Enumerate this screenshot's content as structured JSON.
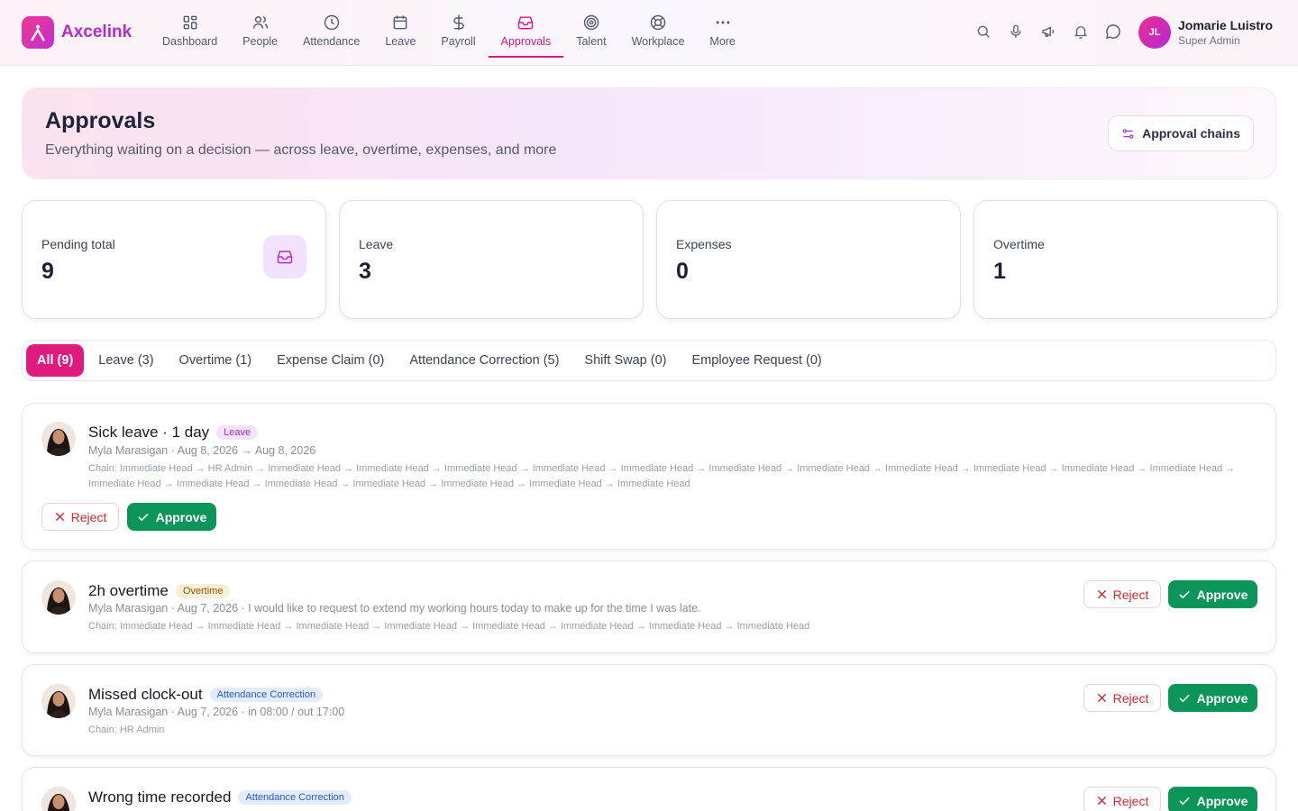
{
  "brand": {
    "name": "Axcelink"
  },
  "nav": [
    {
      "label": "Dashboard",
      "icon": "grid-icon"
    },
    {
      "label": "People",
      "icon": "users-icon"
    },
    {
      "label": "Attendance",
      "icon": "clock-icon"
    },
    {
      "label": "Leave",
      "icon": "calendar-icon"
    },
    {
      "label": "Payroll",
      "icon": "dollar-icon"
    },
    {
      "label": "Approvals",
      "icon": "inbox-icon",
      "active": true
    },
    {
      "label": "Talent",
      "icon": "target-icon"
    },
    {
      "label": "Workplace",
      "icon": "lifebuoy-icon"
    },
    {
      "label": "More",
      "icon": "more-icon"
    }
  ],
  "user": {
    "initials": "JL",
    "name": "Jomarie Luistro",
    "role": "Super Admin"
  },
  "hero": {
    "title": "Approvals",
    "subtitle": "Everything waiting on a decision — across leave, overtime, expenses, and more",
    "chains_label": "Approval chains"
  },
  "stats": [
    {
      "label": "Pending total",
      "value": "9"
    },
    {
      "label": "Leave",
      "value": "3"
    },
    {
      "label": "Expenses",
      "value": "0"
    },
    {
      "label": "Overtime",
      "value": "1"
    }
  ],
  "tabs": [
    "All (9)",
    "Leave (3)",
    "Overtime (1)",
    "Expense Claim (0)",
    "Attendance Correction (5)",
    "Shift Swap (0)",
    "Employee Request (0)"
  ],
  "actions": {
    "reject": "Reject",
    "approve": "Approve"
  },
  "requests": [
    {
      "title": "Sick leave · 1 day",
      "badge": "Leave",
      "meta": "Myla Marasigan · Aug 8, 2026 → Aug 8, 2026",
      "chain": "Chain: Immediate Head → HR Admin → Immediate Head → Immediate Head → Immediate Head → Immediate Head → Immediate Head → Immediate Head → Immediate Head → Immediate Head → Immediate Head → Immediate Head → Immediate Head → Immediate Head → Immediate Head → Immediate Head → Immediate Head → Immediate Head → Immediate Head → Immediate Head"
    },
    {
      "title": "2h overtime",
      "badge": "Overtime",
      "meta": "Myla Marasigan · Aug 7, 2026 · I would like to request to extend my working hours today to make up for the time I was late.",
      "chain": "Chain: Immediate Head → Immediate Head → Immediate Head → Immediate Head → Immediate Head → Immediate Head → Immediate Head → Immediate Head"
    },
    {
      "title": "Missed clock-out",
      "badge": "Attendance Correction",
      "meta": "Myla Marasigan · Aug 7, 2026 · in 08:00 / out 17:00",
      "chain": "Chain: HR Admin"
    },
    {
      "title": "Wrong time recorded",
      "badge": "Attendance Correction",
      "meta": "",
      "chain": ""
    }
  ],
  "colors": {
    "accent": "#e11a7f",
    "brand": "#b32bd0",
    "approve": "#0c9559",
    "reject": "#d3262e"
  }
}
